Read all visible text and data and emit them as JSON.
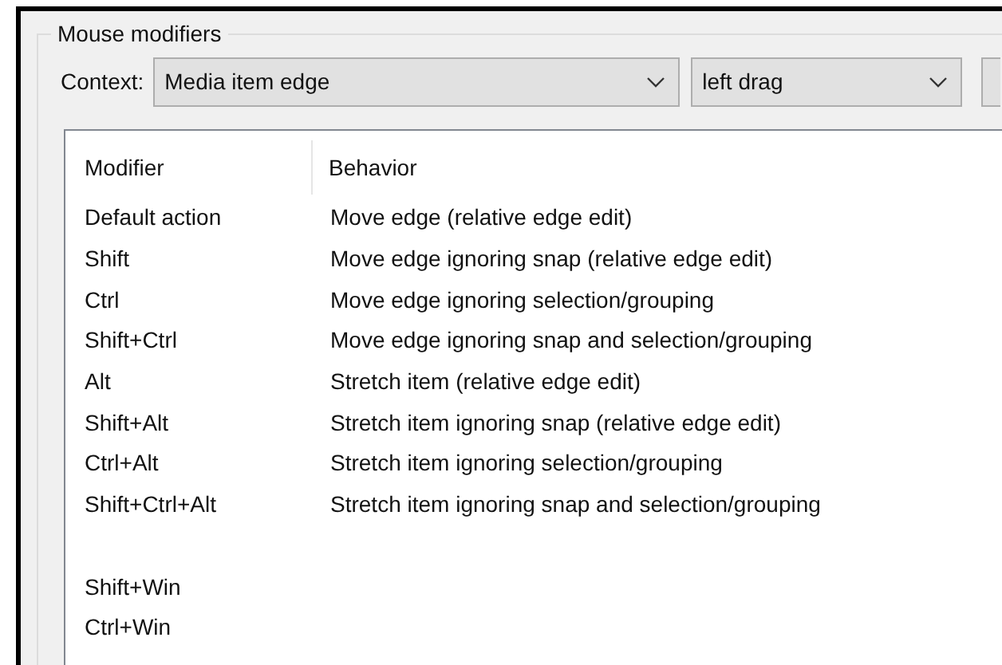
{
  "group": {
    "title": "Mouse modifiers"
  },
  "context": {
    "label": "Context:",
    "dropdowns": [
      {
        "value": "Media item edge"
      },
      {
        "value": "left drag"
      }
    ]
  },
  "table": {
    "columns": [
      "Modifier",
      "Behavior"
    ],
    "rows": [
      {
        "kind": "entry",
        "modifier": "Default action",
        "behavior": "Move edge (relative edge edit)"
      },
      {
        "kind": "entry",
        "modifier": "Shift",
        "behavior": "Move edge ignoring snap (relative edge edit)"
      },
      {
        "kind": "entry",
        "modifier": "Ctrl",
        "behavior": "Move edge ignoring selection/grouping"
      },
      {
        "kind": "entry",
        "modifier": "Shift+Ctrl",
        "behavior": "Move edge ignoring snap and selection/grouping"
      },
      {
        "kind": "entry",
        "modifier": "Alt",
        "behavior": "Stretch item (relative edge edit)"
      },
      {
        "kind": "entry",
        "modifier": "Shift+Alt",
        "behavior": "Stretch item ignoring snap (relative edge edit)"
      },
      {
        "kind": "entry",
        "modifier": "Ctrl+Alt",
        "behavior": "Stretch item ignoring selection/grouping"
      },
      {
        "kind": "entry",
        "modifier": "Shift+Ctrl+Alt",
        "behavior": "Stretch item ignoring snap and selection/grouping"
      },
      {
        "kind": "spacer"
      },
      {
        "kind": "entry",
        "modifier": "Shift+Win"
      },
      {
        "kind": "entry",
        "modifier": "Ctrl+Win"
      }
    ]
  }
}
